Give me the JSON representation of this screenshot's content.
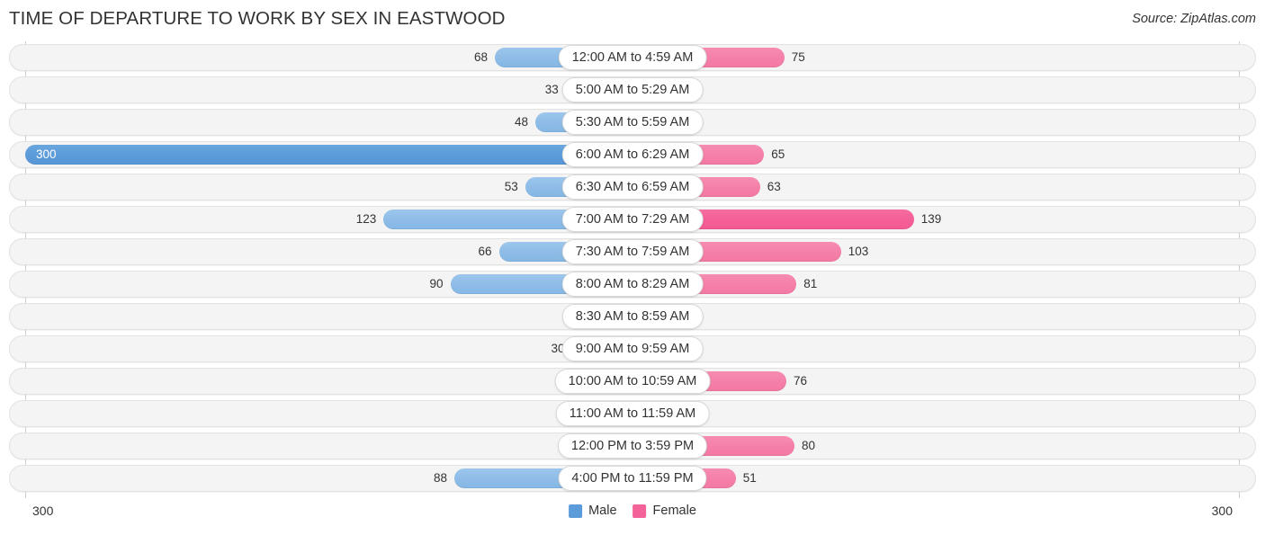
{
  "header": {
    "title": "TIME OF DEPARTURE TO WORK BY SEX IN EASTWOOD",
    "source": "Source: ZipAtlas.com"
  },
  "legend": {
    "male_label": "Male",
    "female_label": "Female",
    "male_color": "#5b9bd9",
    "female_color": "#f4629a"
  },
  "axis": {
    "left_max_label": "300",
    "right_max_label": "300"
  },
  "chart_data": {
    "type": "bar",
    "orientation": "horizontal-diverging",
    "title": "TIME OF DEPARTURE TO WORK BY SEX IN EASTWOOD",
    "xlabel": "",
    "ylabel": "",
    "xlim": [
      0,
      300
    ],
    "grid": false,
    "legend_position": "bottom-center",
    "categories": [
      "12:00 AM to 4:59 AM",
      "5:00 AM to 5:29 AM",
      "5:30 AM to 5:59 AM",
      "6:00 AM to 6:29 AM",
      "6:30 AM to 6:59 AM",
      "7:00 AM to 7:29 AM",
      "7:30 AM to 7:59 AM",
      "8:00 AM to 8:29 AM",
      "8:30 AM to 8:59 AM",
      "9:00 AM to 9:59 AM",
      "10:00 AM to 10:59 AM",
      "11:00 AM to 11:59 AM",
      "12:00 PM to 3:59 PM",
      "4:00 PM to 11:59 PM"
    ],
    "series": [
      {
        "name": "Male",
        "side": "left",
        "color": "#92c0e9",
        "values": [
          68,
          33,
          48,
          300,
          53,
          123,
          66,
          90,
          0,
          30,
          0,
          0,
          0,
          88
        ]
      },
      {
        "name": "Female",
        "side": "right",
        "color": "#f582ab",
        "values": [
          75,
          0,
          0,
          65,
          63,
          139,
          103,
          81,
          0,
          0,
          76,
          0,
          80,
          51
        ]
      }
    ]
  }
}
